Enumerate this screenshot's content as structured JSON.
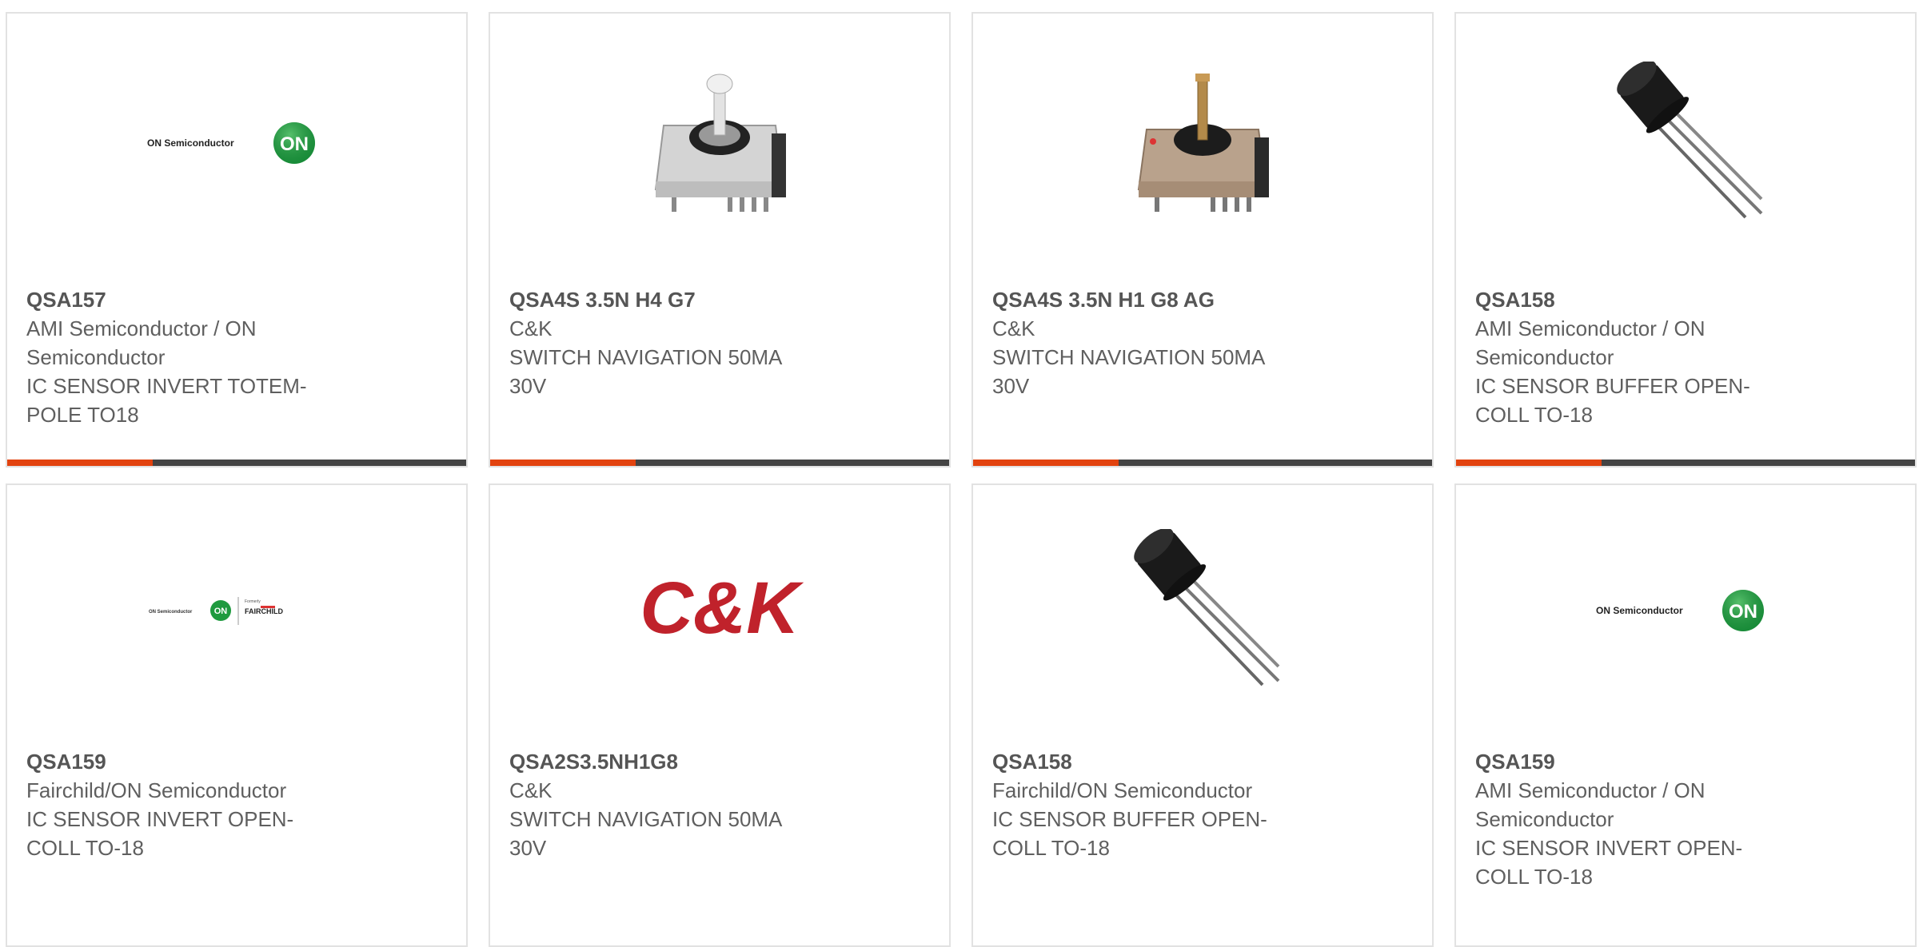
{
  "colors": {
    "accent": "#e2430f",
    "bar": "#444444",
    "border": "#e2e2e2",
    "text": "#5f5f5f",
    "on_green": "#1f9a3f",
    "ck_red": "#c0222b"
  },
  "logos": {
    "on_text": "ON Semiconductor",
    "on_badge": "ON",
    "formerly": "Formerly",
    "fairchild": "FAIRCHILD",
    "ck": "C&K"
  },
  "cards": [
    {
      "part": "QSA157",
      "maker": [
        "AMI Semiconductor / ON",
        "Semiconductor"
      ],
      "desc": [
        "IC SENSOR INVERT TOTEM-",
        "POLE TO18"
      ],
      "image": "on-semiconductor-logo"
    },
    {
      "part": "QSA4S 3.5N H4 G7",
      "maker": [
        "C&K"
      ],
      "desc": [
        "SWITCH NAVIGATION 50MA",
        "30V"
      ],
      "image": "navigation-switch-grey"
    },
    {
      "part": "QSA4S 3.5N H1 G8 AG",
      "maker": [
        "C&K"
      ],
      "desc": [
        "SWITCH NAVIGATION 50MA",
        "30V"
      ],
      "image": "navigation-switch-brass"
    },
    {
      "part": "QSA158",
      "maker": [
        "AMI Semiconductor / ON",
        "Semiconductor"
      ],
      "desc": [
        "IC SENSOR BUFFER OPEN-",
        "COLL TO-18"
      ],
      "image": "to18-sensor"
    },
    {
      "part": "QSA159",
      "maker": [
        "Fairchild/ON Semiconductor"
      ],
      "desc": [
        "IC SENSOR INVERT OPEN-",
        "COLL TO-18"
      ],
      "image": "on-fairchild-logo"
    },
    {
      "part": "QSA2S3.5NH1G8",
      "maker": [
        "C&K"
      ],
      "desc": [
        "SWITCH NAVIGATION 50MA",
        "30V"
      ],
      "image": "ck-logo"
    },
    {
      "part": "QSA158",
      "maker": [
        "Fairchild/ON Semiconductor"
      ],
      "desc": [
        "IC SENSOR BUFFER OPEN-",
        "COLL TO-18"
      ],
      "image": "to18-sensor"
    },
    {
      "part": "QSA159",
      "maker": [
        "AMI Semiconductor / ON",
        "Semiconductor"
      ],
      "desc": [
        "IC SENSOR INVERT OPEN-",
        "COLL TO-18"
      ],
      "image": "on-semiconductor-logo"
    }
  ]
}
